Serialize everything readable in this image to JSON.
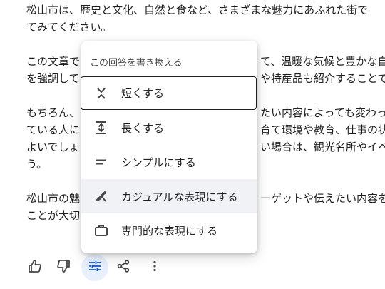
{
  "article": {
    "lines": [
      "松山市は、歴史と文化、自然と食など、さまざまな魅力にあふれた街で",
      "てみてください。",
      "この文章で",
      "て、温暖な気候と豊かな自",
      "を強調して",
      "や特産品も紹介することで",
      "もちろん、",
      "たい内容によっても変わっ",
      "ている人に",
      "育て環境や教育、仕事の状",
      "よいでしょ",
      "い場合は、観光名所やイベ",
      "う。",
      "松山市の魅",
      "ーゲットや伝えたい内容を",
      "ことが大切"
    ]
  },
  "menu": {
    "header": "この回答を書き換える",
    "items": [
      {
        "label": "短くする",
        "icon": "shorten-icon"
      },
      {
        "label": "長くする",
        "icon": "lengthen-icon"
      },
      {
        "label": "シンプルにする",
        "icon": "simplify-icon"
      },
      {
        "label": "カジュアルな表現にする",
        "icon": "casual-icon"
      },
      {
        "label": "専門的な表現にする",
        "icon": "briefcase-icon"
      }
    ]
  },
  "colors": {
    "text": "#1f1f1f",
    "muted": "#444746",
    "icon": "#444746",
    "active_bg": "#e8f0fe",
    "active_icon": "#0b57d0",
    "hover_bg": "#f0f2f5"
  },
  "toolbar": {
    "buttons": [
      "thumbs-up-icon",
      "thumbs-down-icon",
      "tune-icon",
      "share-icon",
      "more-vert-icon"
    ]
  }
}
